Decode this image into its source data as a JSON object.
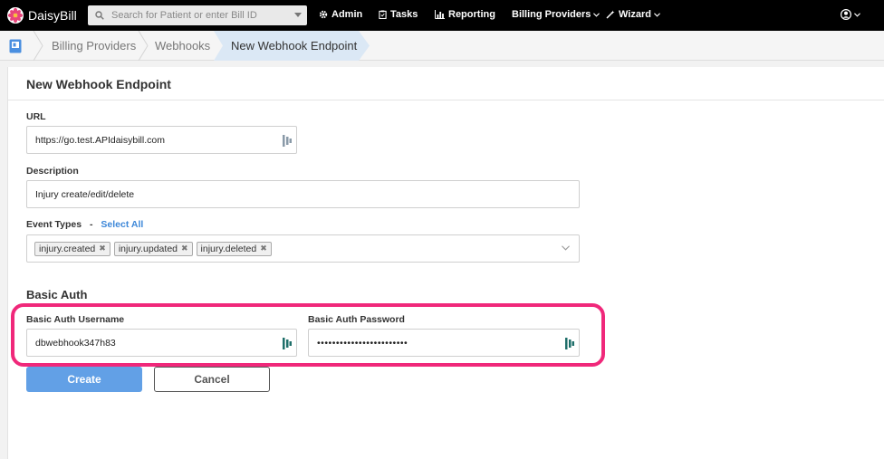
{
  "navbar": {
    "brand": "DaisyBill",
    "search_placeholder": "Search for Patient or enter Bill ID",
    "admin": "Admin",
    "tasks": "Tasks",
    "reporting": "Reporting",
    "billing_providers": "Billing Providers",
    "wizard": "Wizard"
  },
  "breadcrumb": {
    "items": [
      "Billing Providers",
      "Webhooks",
      "New Webhook Endpoint"
    ]
  },
  "form": {
    "title": "New Webhook Endpoint",
    "url_label": "URL",
    "url_value": "https://go.test.APIdaisybill.com",
    "description_label": "Description",
    "description_value": "Injury create/edit/delete",
    "event_types_label": "Event Types",
    "event_types_sep": "-",
    "select_all": "Select All",
    "event_tags": [
      "injury.created",
      "injury.updated",
      "injury.deleted"
    ],
    "basic_auth_title": "Basic Auth",
    "username_label": "Basic Auth Username",
    "username_value": "dbwebhook347h83",
    "password_label": "Basic Auth Password",
    "password_value": "••••••••••••••••••••••••",
    "create_label": "Create",
    "cancel_label": "Cancel"
  },
  "colors": {
    "accent": "#62a0e6",
    "highlight": "#f0287a",
    "link": "#3d87d8"
  }
}
